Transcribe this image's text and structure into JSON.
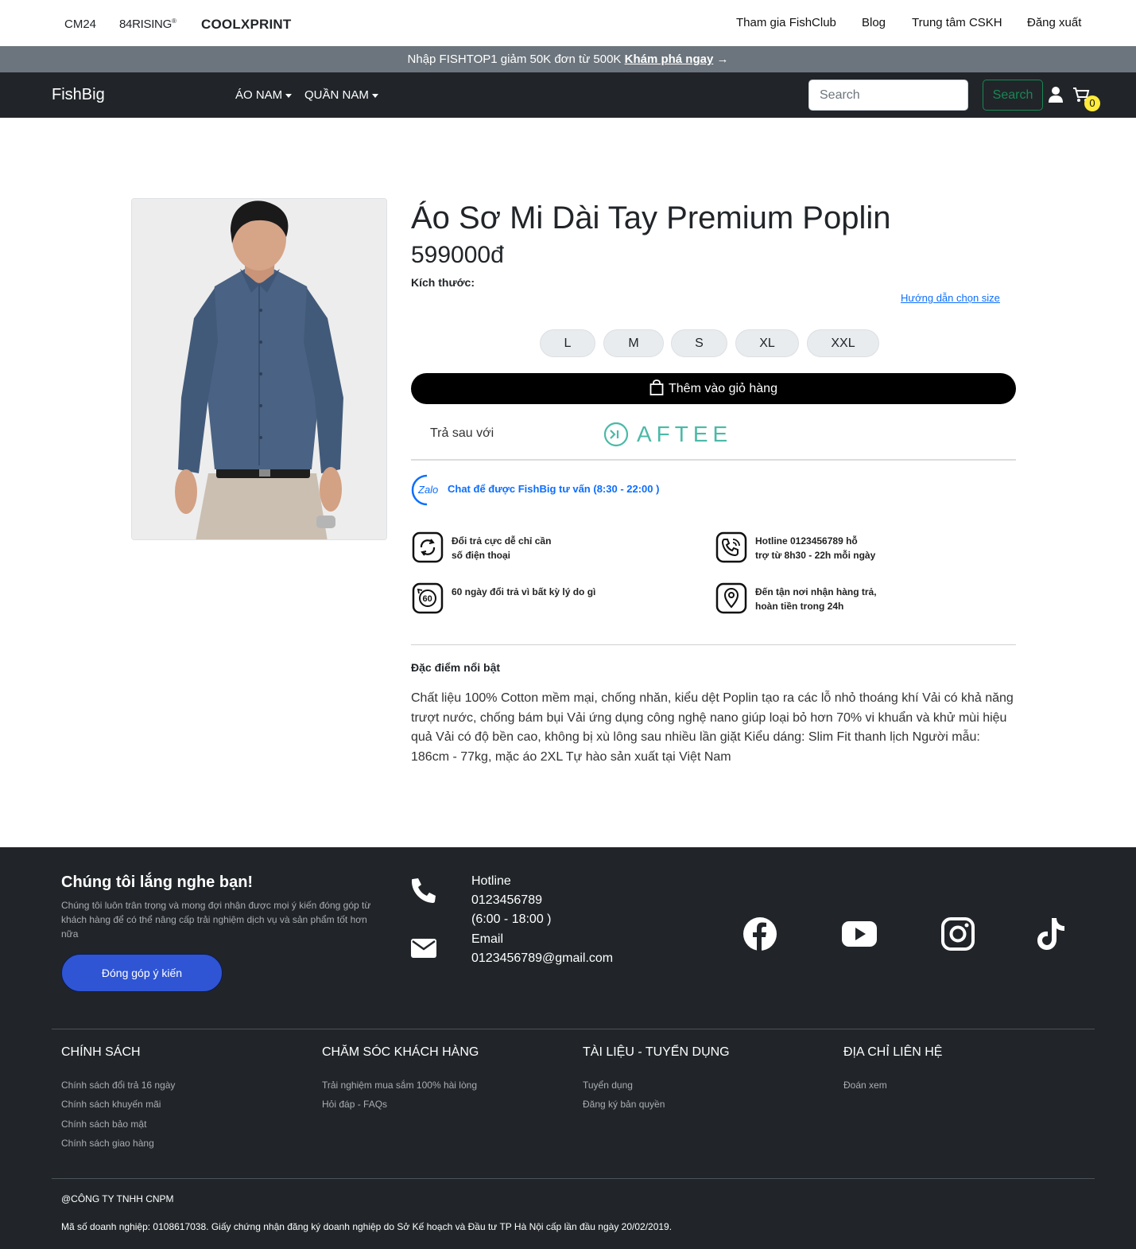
{
  "topbar": {
    "brands": [
      "CM24",
      "84RISING",
      "®",
      "COOLXPRINT"
    ],
    "links": [
      "Tham gia FishClub",
      "Blog",
      "Trung tâm CSKH",
      "Đăng xuất"
    ]
  },
  "promo": {
    "text": "Nhập FISHTOP1 giảm 50K đơn từ 500K",
    "link": "Khám phá ngay",
    "arrow": "→"
  },
  "navbar": {
    "brand": "FishBig",
    "menu": [
      "ÁO NAM",
      "QUẦN NAM"
    ],
    "search_placeholder": "Search",
    "search_button": "Search",
    "cart_count": "0"
  },
  "product": {
    "title": "Áo Sơ Mi Dài Tay Premium Poplin",
    "price": "599000đ",
    "size_label": "Kích thước:",
    "size_guide": "Hướng dẫn chọn size",
    "sizes": [
      "L",
      "M",
      "S",
      "XL",
      "XXL"
    ],
    "add_to_cart": "Thêm vào giỏ hàng",
    "pay_later": "Trả sau với",
    "aftee": "AFTEE",
    "zalo_label": "Zalo",
    "zalo_text": "Chat để được FishBig tư vấn (8:30 - 22:00 )",
    "features": [
      {
        "icon": "return-icon",
        "line1": "Đổi trả cực dễ chỉ cần",
        "line2": "số điện thoại"
      },
      {
        "icon": "hotline-icon",
        "line1": "Hotline 0123456789 hỗ",
        "line2": "trợ từ 8h30 - 22h mỗi ngày"
      },
      {
        "icon": "60-days-icon",
        "line1": "60 ngày đổi trả vì bất kỳ lý do gì",
        "line2": ""
      },
      {
        "icon": "location-icon",
        "line1": "Đến tận nơi nhận hàng trả,",
        "line2": "hoàn tiền trong 24h"
      }
    ],
    "highlight_title": "Đặc điểm nổi bật",
    "description": "Chất liệu 100% Cotton mềm mại, chống nhăn, kiểu dệt Poplin tạo ra các lỗ nhỏ thoáng khí Vải có khả năng trượt nước, chống bám bụi Vải ứng dụng công nghệ nano giúp loại bỏ hơn 70% vi khuẩn và khử mùi hiệu quả Vải có độ bền cao, không bị xù lông sau nhiều lần giặt Kiểu dáng: Slim Fit thanh lịch Người mẫu: 186cm - 77kg, mặc áo 2XL Tự hào sản xuất tại Việt Nam"
  },
  "footer": {
    "title": "Chúng tôi lắng nghe bạn!",
    "desc": "Chúng tôi luôn trân trọng và mong đợi nhận được mọi ý kiến đóng góp từ khách hàng để có thể nâng cấp trải nghiệm dịch vụ và sản phẩm tốt hơn nữa",
    "feedback_button": "Đóng góp ý kiến",
    "hotline_label": "Hotline",
    "hotline_number": "0123456789",
    "hotline_hours": "(6:00 - 18:00 )",
    "email_label": "Email",
    "email": "0123456789@gmail.com",
    "social": [
      "facebook-icon",
      "youtube-icon",
      "instagram-icon",
      "tiktok-icon"
    ],
    "columns": [
      {
        "title": "CHÍNH SÁCH",
        "links": [
          "Chính sách đổi trả 16 ngày",
          "Chính sách khuyến mãi",
          "Chính sách bảo mật",
          "Chính sách giao hàng"
        ]
      },
      {
        "title": "CHĂM SÓC KHÁCH HÀNG",
        "links": [
          "Trải nghiệm mua sắm 100% hài lòng",
          "Hỏi đáp - FAQs"
        ]
      },
      {
        "title": "TÀI LIỆU - TUYỂN DỤNG",
        "links": [
          "Tuyển dụng",
          "Đăng ký bản quyền"
        ]
      },
      {
        "title": "ĐỊA CHỈ LIÊN HỆ",
        "links": [
          "Đoán xem"
        ]
      }
    ],
    "company": "@CÔNG TY TNHH CNPM",
    "license": "Mã số doanh nghiệp: 0108617038. Giấy chứng nhận đăng ký doanh nghiệp do Sở Kế hoạch và Đầu tư TP Hà Nội cấp lần đầu ngày 20/02/2019."
  },
  "colors": {
    "navbar_bg": "#212529",
    "promo_bg": "#6c757d",
    "search_green": "#198754",
    "link_blue": "#0d6efd",
    "aftee_teal": "#4bb9a7",
    "feedback_blue": "#2f55d4",
    "badge_yellow": "#ffeb3b"
  }
}
